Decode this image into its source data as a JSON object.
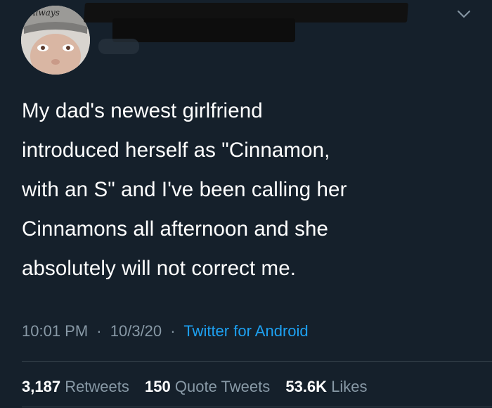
{
  "tweet": {
    "avatar_caption": "Always",
    "text": "My dad's newest girlfriend\nintroduced herself as \"Cinnamon,\nwith an S\" and I've been calling her\nCinnamons all afternoon and she\nabsolutely will not correct me.",
    "time": "10:01 PM",
    "date": "10/3/20",
    "source": "Twitter for Android",
    "separator": "·"
  },
  "stats": {
    "retweets_count": "3,187",
    "retweets_label": "Retweets",
    "quote_count": "150",
    "quote_label": "Quote Tweets",
    "likes_count": "53.6K",
    "likes_label": "Likes"
  },
  "colors": {
    "background": "#15202b",
    "muted": "#8899a6",
    "accent": "#1da1f2",
    "divider": "#38444d"
  },
  "icons": {
    "menu": "chevron-down-icon"
  }
}
